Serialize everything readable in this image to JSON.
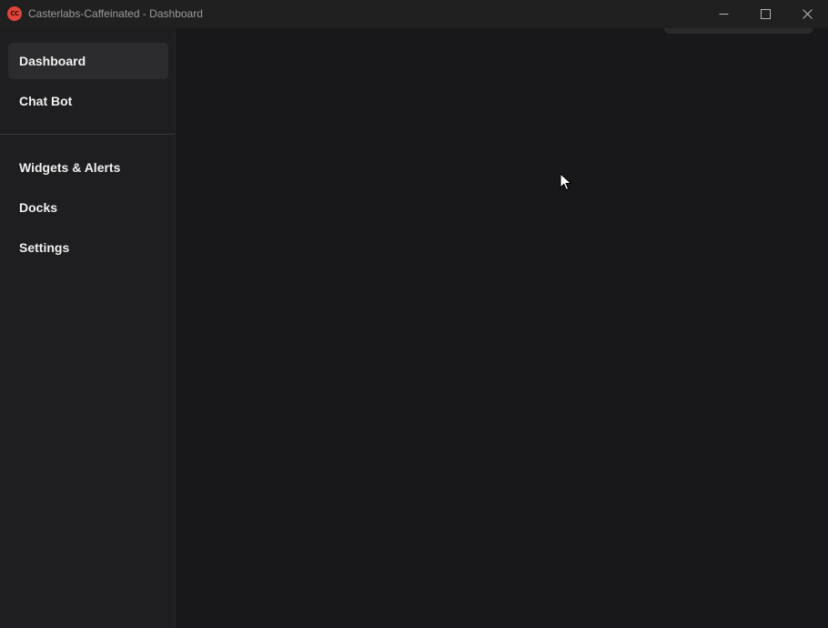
{
  "window": {
    "title": "Casterlabs-Caffeinated - Dashboard",
    "logo_text": "CC",
    "controls": {
      "minimize": "minimize-icon",
      "maximize": "maximize-icon",
      "close": "close-icon"
    }
  },
  "sidebar": {
    "primary_items": [
      {
        "label": "Dashboard",
        "active": true
      },
      {
        "label": "Chat Bot",
        "active": false
      }
    ],
    "secondary_items": [
      {
        "label": "Widgets & Alerts",
        "active": false
      },
      {
        "label": "Docks",
        "active": false
      },
      {
        "label": "Settings",
        "active": false
      }
    ]
  },
  "colors": {
    "logo": "#e0443a",
    "sidebar_bg": "#1e1e20",
    "main_bg": "#18181a",
    "active_item_bg": "#2c2c2f",
    "text": "#f0f0f0"
  }
}
